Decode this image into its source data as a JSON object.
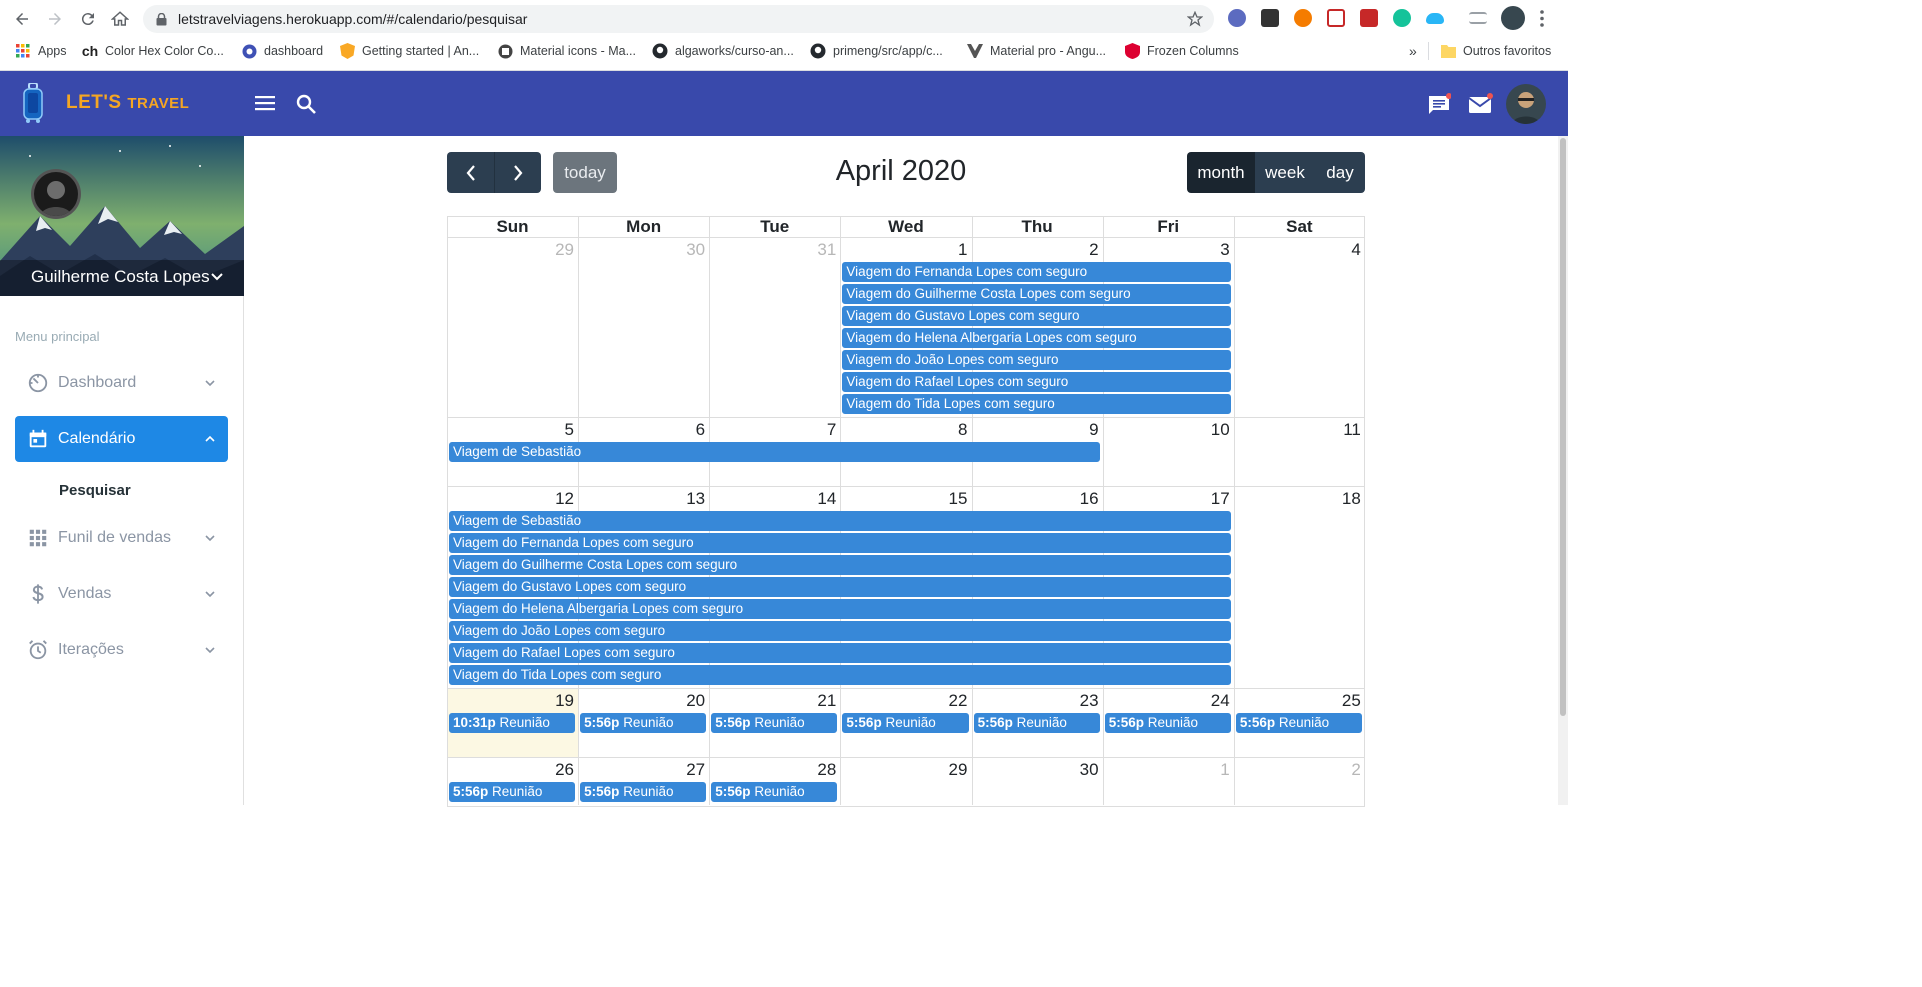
{
  "browser": {
    "url": "letstravelviagens.herokuapp.com/#/calendario/pesquisar",
    "bookmarks": [
      {
        "label": "Apps",
        "icon": "apps-grid-icon"
      },
      {
        "label": "Color Hex Color Co...",
        "icon": "colorhex-icon"
      },
      {
        "label": "dashboard",
        "icon": "dashboard-site-icon"
      },
      {
        "label": "Getting started | An...",
        "icon": "angular-icon"
      },
      {
        "label": "Material icons - Ma...",
        "icon": "material-icon"
      },
      {
        "label": "algaworks/curso-an...",
        "icon": "github-icon"
      },
      {
        "label": "primeng/src/app/c...",
        "icon": "github-icon"
      },
      {
        "label": "Material pro - Angu...",
        "icon": "materialpro-icon"
      },
      {
        "label": "Frozen Columns",
        "icon": "primeng-icon"
      }
    ],
    "more_bookmarks": "»",
    "other_bookmarks": "Outros favoritos"
  },
  "app": {
    "logo_main": "LET'S",
    "logo_sub": "TRAVEL",
    "user_name": "Guilherme Costa Lopes",
    "colors": {
      "header": "#3949ab",
      "accent": "#1e88e5",
      "event": "#3788d8",
      "today_bg": "#fcf8e3"
    }
  },
  "sidebar": {
    "section_title": "Menu principal",
    "items": [
      {
        "label": "Dashboard",
        "icon": "dashboard-gauge-icon",
        "expanded": false
      },
      {
        "label": "Calendário",
        "icon": "calendar-icon",
        "expanded": true,
        "active": true
      },
      {
        "label": "Pesquisar",
        "sub": true
      },
      {
        "label": "Funil de vendas",
        "icon": "grid-apps-icon",
        "expanded": false
      },
      {
        "label": "Vendas",
        "icon": "dollar-icon",
        "expanded": false
      },
      {
        "label": "Iterações",
        "icon": "alarm-icon",
        "expanded": false
      }
    ]
  },
  "calendar": {
    "title": "April 2020",
    "today_label": "today",
    "view_buttons": [
      "month",
      "week",
      "day"
    ],
    "active_view": "month",
    "day_names": [
      "Sun",
      "Mon",
      "Tue",
      "Wed",
      "Thu",
      "Fri",
      "Sat"
    ],
    "weeks": [
      [
        "29",
        "30",
        "31",
        "1",
        "2",
        "3",
        "4"
      ],
      [
        "5",
        "6",
        "7",
        "8",
        "9",
        "10",
        "11"
      ],
      [
        "12",
        "13",
        "14",
        "15",
        "16",
        "17",
        "18"
      ],
      [
        "19",
        "20",
        "21",
        "22",
        "23",
        "24",
        "25"
      ],
      [
        "26",
        "27",
        "28",
        "29",
        "30",
        "1",
        "2"
      ]
    ],
    "other_month": [
      [
        true,
        true,
        true,
        false,
        false,
        false,
        false
      ],
      [
        false,
        false,
        false,
        false,
        false,
        false,
        false
      ],
      [
        false,
        false,
        false,
        false,
        false,
        false,
        false
      ],
      [
        false,
        false,
        false,
        false,
        false,
        false,
        false
      ],
      [
        false,
        false,
        false,
        false,
        false,
        true,
        true
      ]
    ],
    "today": [
      3,
      0
    ],
    "events": [
      {
        "week": 0,
        "start": 3,
        "end": 5,
        "slot": 0,
        "title": "Viagem do Fernanda Lopes com seguro"
      },
      {
        "week": 0,
        "start": 3,
        "end": 5,
        "slot": 1,
        "title": "Viagem do Guilherme Costa Lopes com seguro"
      },
      {
        "week": 0,
        "start": 3,
        "end": 5,
        "slot": 2,
        "title": "Viagem do Gustavo Lopes com seguro"
      },
      {
        "week": 0,
        "start": 3,
        "end": 5,
        "slot": 3,
        "title": "Viagem do Helena Albergaria Lopes com seguro"
      },
      {
        "week": 0,
        "start": 3,
        "end": 5,
        "slot": 4,
        "title": "Viagem do João Lopes com seguro"
      },
      {
        "week": 0,
        "start": 3,
        "end": 5,
        "slot": 5,
        "title": "Viagem do Rafael Lopes com seguro"
      },
      {
        "week": 0,
        "start": 3,
        "end": 5,
        "slot": 6,
        "title": "Viagem do Tida Lopes com seguro"
      },
      {
        "week": 1,
        "start": 0,
        "end": 4,
        "slot": 0,
        "title": "Viagem de Sebastião"
      },
      {
        "week": 2,
        "start": 0,
        "end": 5,
        "slot": 0,
        "title": "Viagem de Sebastião"
      },
      {
        "week": 2,
        "start": 0,
        "end": 5,
        "slot": 1,
        "title": "Viagem do Fernanda Lopes com seguro"
      },
      {
        "week": 2,
        "start": 0,
        "end": 5,
        "slot": 2,
        "title": "Viagem do Guilherme Costa Lopes com seguro"
      },
      {
        "week": 2,
        "start": 0,
        "end": 5,
        "slot": 3,
        "title": "Viagem do Gustavo Lopes com seguro"
      },
      {
        "week": 2,
        "start": 0,
        "end": 5,
        "slot": 4,
        "title": "Viagem do Helena Albergaria Lopes com seguro"
      },
      {
        "week": 2,
        "start": 0,
        "end": 5,
        "slot": 5,
        "title": "Viagem do João Lopes com seguro"
      },
      {
        "week": 2,
        "start": 0,
        "end": 5,
        "slot": 6,
        "title": "Viagem do Rafael Lopes com seguro"
      },
      {
        "week": 2,
        "start": 0,
        "end": 5,
        "slot": 7,
        "title": "Viagem do Tida Lopes com seguro"
      },
      {
        "week": 3,
        "start": 0,
        "end": 0,
        "slot": 0,
        "time": "10:31p",
        "title": "Reunião"
      },
      {
        "week": 3,
        "start": 1,
        "end": 1,
        "slot": 0,
        "time": "5:56p",
        "title": "Reunião"
      },
      {
        "week": 3,
        "start": 2,
        "end": 2,
        "slot": 0,
        "time": "5:56p",
        "title": "Reunião"
      },
      {
        "week": 3,
        "start": 3,
        "end": 3,
        "slot": 0,
        "time": "5:56p",
        "title": "Reunião"
      },
      {
        "week": 3,
        "start": 4,
        "end": 4,
        "slot": 0,
        "time": "5:56p",
        "title": "Reunião"
      },
      {
        "week": 3,
        "start": 5,
        "end": 5,
        "slot": 0,
        "time": "5:56p",
        "title": "Reunião"
      },
      {
        "week": 3,
        "start": 6,
        "end": 6,
        "slot": 0,
        "time": "5:56p",
        "title": "Reunião"
      },
      {
        "week": 4,
        "start": 0,
        "end": 0,
        "slot": 0,
        "time": "5:56p",
        "title": "Reunião"
      },
      {
        "week": 4,
        "start": 1,
        "end": 1,
        "slot": 0,
        "time": "5:56p",
        "title": "Reunião"
      },
      {
        "week": 4,
        "start": 2,
        "end": 2,
        "slot": 0,
        "time": "5:56p",
        "title": "Reunião"
      }
    ]
  }
}
